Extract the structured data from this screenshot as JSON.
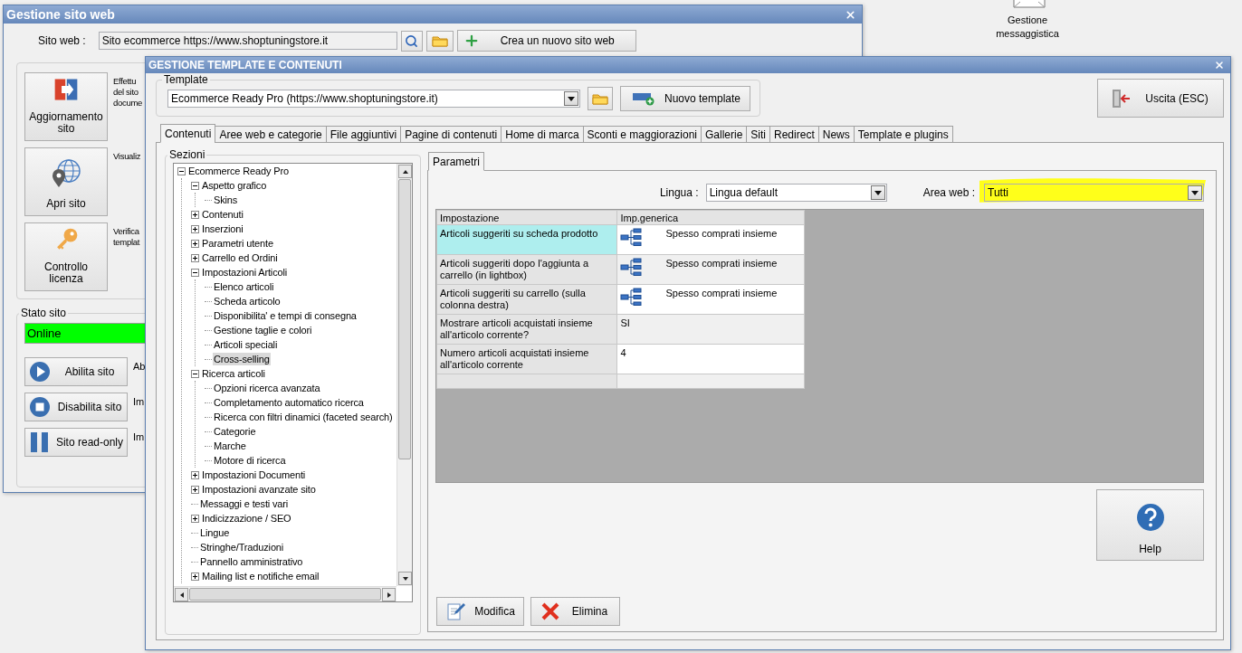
{
  "desktop": {
    "icon_label": "Gestione messaggistica"
  },
  "back_window": {
    "title": "Gestione sito web",
    "site_label": "Sito web :",
    "site_value": "Sito ecommerce https://www.shoptuningstore.it",
    "create_button": "Crea un nuovo sito web",
    "actions": [
      {
        "label": "Aggiornamento sito",
        "kind": "update",
        "description": [
          "Effettu",
          "del sito",
          "docume"
        ]
      },
      {
        "label": "Apri sito",
        "kind": "open",
        "description": [
          "Visualiz"
        ]
      },
      {
        "label": "Controllo licenza",
        "kind": "license",
        "description": [
          "Verifica",
          "templat"
        ]
      }
    ],
    "status_group": "Stato sito",
    "status": "Online",
    "online": true,
    "status_buttons": [
      {
        "label": "Abilita sito",
        "kind": "play",
        "note": "Ab"
      },
      {
        "label": "Disabilita sito",
        "kind": "stop",
        "note": "Im"
      },
      {
        "label": "Sito read-only",
        "kind": "pause",
        "note": "Im"
      }
    ]
  },
  "window": {
    "title": "GESTIONE TEMPLATE E CONTENUTI",
    "template_group": "Template",
    "template_value": "Ecommerce Ready Pro (https://www.shoptuningstore.it)",
    "new_template_button": "Nuovo template",
    "exit_button": "Uscita (ESC)",
    "tabs": [
      {
        "label": "Contenuti",
        "selected": true
      },
      {
        "label": "Aree web e categorie",
        "selected": false
      },
      {
        "label": "File aggiuntivi",
        "selected": false
      },
      {
        "label": "Pagine di contenuti",
        "selected": false
      },
      {
        "label": "Home di marca",
        "selected": false
      },
      {
        "label": "Sconti e maggiorazioni",
        "selected": false
      },
      {
        "label": "Gallerie",
        "selected": false
      },
      {
        "label": "Siti",
        "selected": false
      },
      {
        "label": "Redirect",
        "selected": false
      },
      {
        "label": "News",
        "selected": false
      },
      {
        "label": "Template e plugins",
        "selected": false
      }
    ],
    "sections": {
      "title": "Sezioni",
      "tree": [
        {
          "label": "Ecommerce Ready Pro",
          "expanded": true,
          "selected": false,
          "children": [
            {
              "label": "Aspetto grafico",
              "expanded": true,
              "selected": false,
              "children": [
                {
                  "label": "Skins",
                  "selected": false
                }
              ]
            },
            {
              "label": "Contenuti",
              "expanded": false,
              "selected": false
            },
            {
              "label": "Inserzioni",
              "expanded": false,
              "selected": false
            },
            {
              "label": "Parametri utente",
              "expanded": false,
              "selected": false
            },
            {
              "label": "Carrello ed Ordini",
              "expanded": false,
              "selected": false
            },
            {
              "label": "Impostazioni Articoli",
              "expanded": true,
              "selected": false,
              "children": [
                {
                  "label": "Elenco articoli",
                  "selected": false
                },
                {
                  "label": "Scheda articolo",
                  "selected": false
                },
                {
                  "label": "Disponibilita' e tempi di consegna",
                  "selected": false
                },
                {
                  "label": "Gestione taglie e colori",
                  "selected": false
                },
                {
                  "label": "Articoli speciali",
                  "selected": false
                },
                {
                  "label": "Cross-selling",
                  "selected": true
                }
              ]
            },
            {
              "label": "Ricerca articoli",
              "expanded": true,
              "selected": false,
              "children": [
                {
                  "label": "Opzioni ricerca avanzata",
                  "selected": false
                },
                {
                  "label": "Completamento automatico ricerca",
                  "selected": false
                },
                {
                  "label": "Ricerca con filtri dinamici (faceted search)",
                  "selected": false
                },
                {
                  "label": "Categorie",
                  "selected": false
                },
                {
                  "label": "Marche",
                  "selected": false
                },
                {
                  "label": "Motore di ricerca",
                  "selected": false
                }
              ]
            },
            {
              "label": "Impostazioni Documenti",
              "expanded": false,
              "selected": false
            },
            {
              "label": "Impostazioni avanzate sito",
              "expanded": false,
              "selected": false
            },
            {
              "label": "Messaggi e testi vari",
              "selected": false
            },
            {
              "label": "Indicizzazione / SEO",
              "expanded": false,
              "selected": false
            },
            {
              "label": "Lingue",
              "selected": false
            },
            {
              "label": "Stringhe/Traduzioni",
              "selected": false
            },
            {
              "label": "Pannello amministrativo",
              "selected": false
            },
            {
              "label": "Mailing list e notifiche email",
              "expanded": false,
              "selected": false
            }
          ]
        }
      ]
    },
    "subtabs": [
      {
        "label": "Parametri",
        "selected": true
      }
    ],
    "language_label": "Lingua :",
    "language_value": "Lingua default",
    "area_label": "Area web :",
    "area_value": "Tutti",
    "area_highlighted": true,
    "table": {
      "columns": [
        "Impostazione",
        "Imp.generica"
      ],
      "rows": [
        {
          "setting": "Articoli suggeriti su scheda prodotto",
          "value": "Spesso comprati insieme",
          "has_icon": true,
          "selected": true
        },
        {
          "setting": "Articoli suggeriti dopo l'aggiunta a carrello (in lightbox)",
          "value": "Spesso comprati insieme",
          "has_icon": true,
          "selected": false
        },
        {
          "setting": "Articoli suggeriti su carrello (sulla colonna destra)",
          "value": "Spesso comprati insieme",
          "has_icon": true,
          "selected": false
        },
        {
          "setting": "Mostrare articoli acquistati insieme all'articolo corrente?",
          "value": "SI",
          "has_icon": false,
          "selected": false
        },
        {
          "setting": "Numero articoli acquistati insieme all'articolo corrente",
          "value": "4",
          "has_icon": false,
          "selected": false
        }
      ]
    },
    "help_button": "Help",
    "edit_button": "Modifica",
    "delete_button": "Elimina"
  }
}
